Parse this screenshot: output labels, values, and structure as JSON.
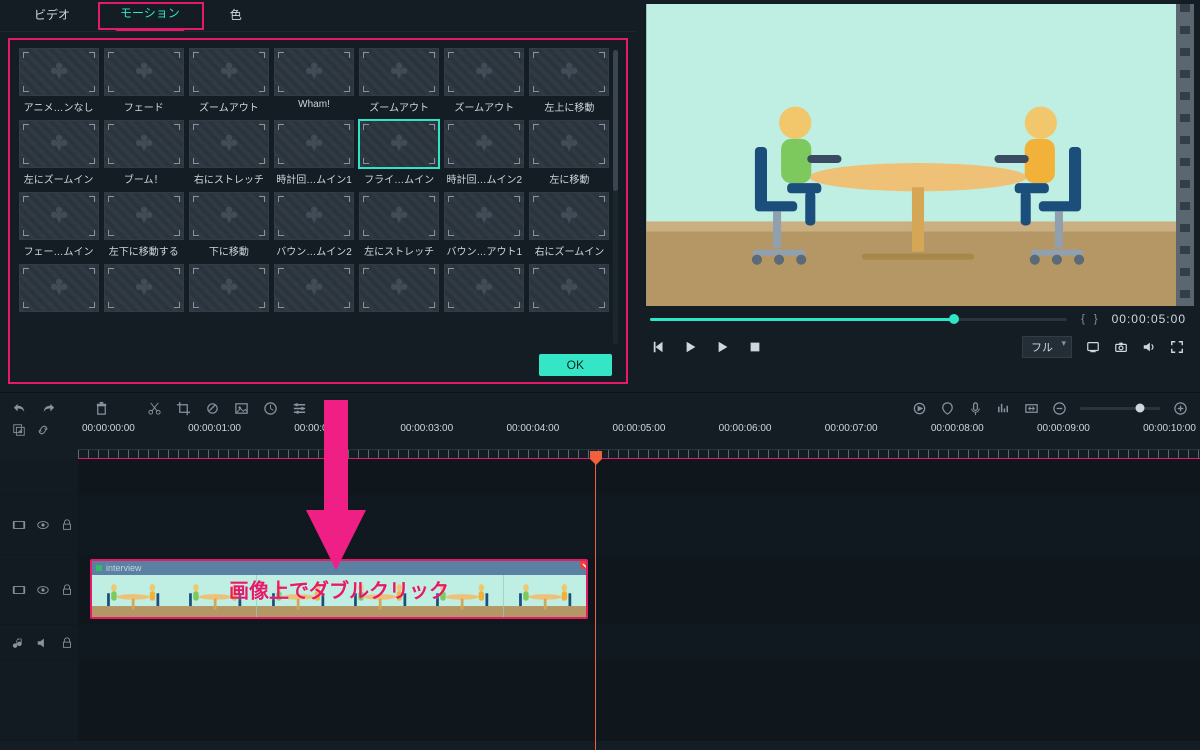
{
  "tabs": {
    "video": "ビデオ",
    "motion": "モーション",
    "color": "色"
  },
  "motion_panel": {
    "scrollbar_pos": 0,
    "items": [
      {
        "label": "アニメ…ンなし",
        "selected": false
      },
      {
        "label": "フェード",
        "selected": false
      },
      {
        "label": "ズームアウト",
        "selected": false
      },
      {
        "label": "Wham!",
        "selected": false
      },
      {
        "label": "ズームアウト",
        "selected": false
      },
      {
        "label": "ズームアウト",
        "selected": false
      },
      {
        "label": "左上に移動",
        "selected": false
      },
      {
        "label": "左にズームイン",
        "selected": false
      },
      {
        "label": "ブーム！",
        "selected": false
      },
      {
        "label": "右にストレッチ",
        "selected": false
      },
      {
        "label": "時計回…ムイン1",
        "selected": false
      },
      {
        "label": "フライ…ムイン",
        "selected": true
      },
      {
        "label": "時計回…ムイン2",
        "selected": false
      },
      {
        "label": "左に移動",
        "selected": false
      },
      {
        "label": "フェー…ムイン",
        "selected": false
      },
      {
        "label": "左下に移動する",
        "selected": false
      },
      {
        "label": "下に移動",
        "selected": false
      },
      {
        "label": "バウン…ムイン2",
        "selected": false
      },
      {
        "label": "左にストレッチ",
        "selected": false
      },
      {
        "label": "バウン…アウト1",
        "selected": false
      },
      {
        "label": "右にズームイン",
        "selected": false
      },
      {
        "label": "",
        "selected": false
      },
      {
        "label": "",
        "selected": false
      },
      {
        "label": "",
        "selected": false
      },
      {
        "label": "",
        "selected": false
      },
      {
        "label": "",
        "selected": false
      },
      {
        "label": "",
        "selected": false
      },
      {
        "label": "",
        "selected": false
      }
    ],
    "ok": "OK"
  },
  "preview": {
    "timecode": "00:00:05:00",
    "scrub_percent": 73,
    "size_label": "フル"
  },
  "timeline": {
    "ruler": [
      "00:00:00:00",
      "00:00:01:00",
      "00:00:02:00",
      "00:00:03:00",
      "00:00:04:00",
      "00:00:05:00",
      "00:00:06:00",
      "00:00:07:00",
      "00:00:08:00",
      "00:00:09:00",
      "00:00:10:00"
    ],
    "clip_name": "interview",
    "overlay_text": "画像上でダブルクリック"
  }
}
